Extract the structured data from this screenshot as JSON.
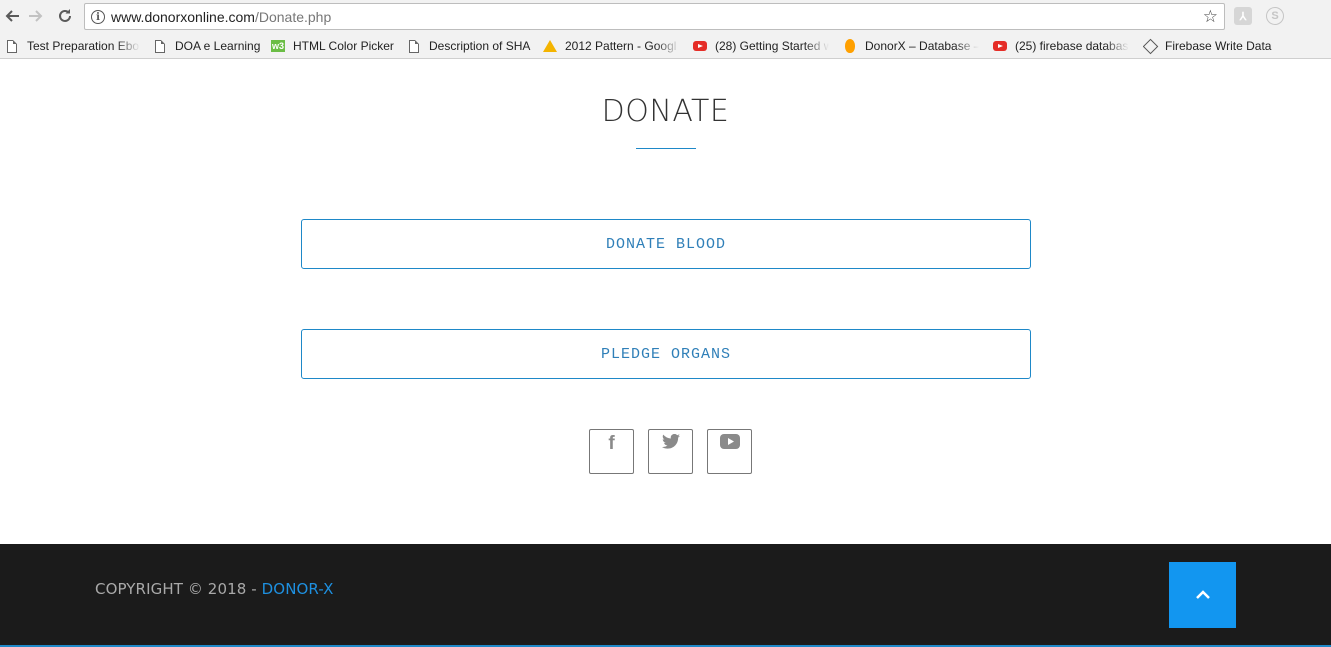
{
  "browser": {
    "url_host": "www.donorxonline.com",
    "url_path": "/Donate.php",
    "bookmarks": [
      {
        "label": "Test Preparation Ebo",
        "icon": "page-icon"
      },
      {
        "label": "DOA e Learning",
        "icon": "page-icon"
      },
      {
        "label": "HTML Color Picker",
        "icon": "w3schools-icon"
      },
      {
        "label": "Description of SHA",
        "icon": "page-icon"
      },
      {
        "label": "2012 Pattern - Googl",
        "icon": "google-drive-icon"
      },
      {
        "label": "(28) Getting Started w",
        "icon": "youtube-icon"
      },
      {
        "label": "DonorX – Database –",
        "icon": "firebase-icon"
      },
      {
        "label": "(25) firebase databas",
        "icon": "youtube-icon"
      },
      {
        "label": "Firebase Write Data",
        "icon": "diamond-icon"
      }
    ]
  },
  "page": {
    "title": "DONATE",
    "buttons": {
      "donate_blood": "DONATE BLOOD",
      "pledge_organs": "PLEDGE ORGANS"
    },
    "social": [
      "facebook-icon",
      "twitter-icon",
      "youtube-icon"
    ]
  },
  "footer": {
    "copyright_prefix": "COPYRIGHT © 2018 - ",
    "brand": "DONOR-X",
    "back_to_top_icon": "chevron-up-icon"
  },
  "colors": {
    "accent": "#1e88c8",
    "footer_bg": "#1b1b1b",
    "back_to_top_bg": "#1296f0"
  }
}
